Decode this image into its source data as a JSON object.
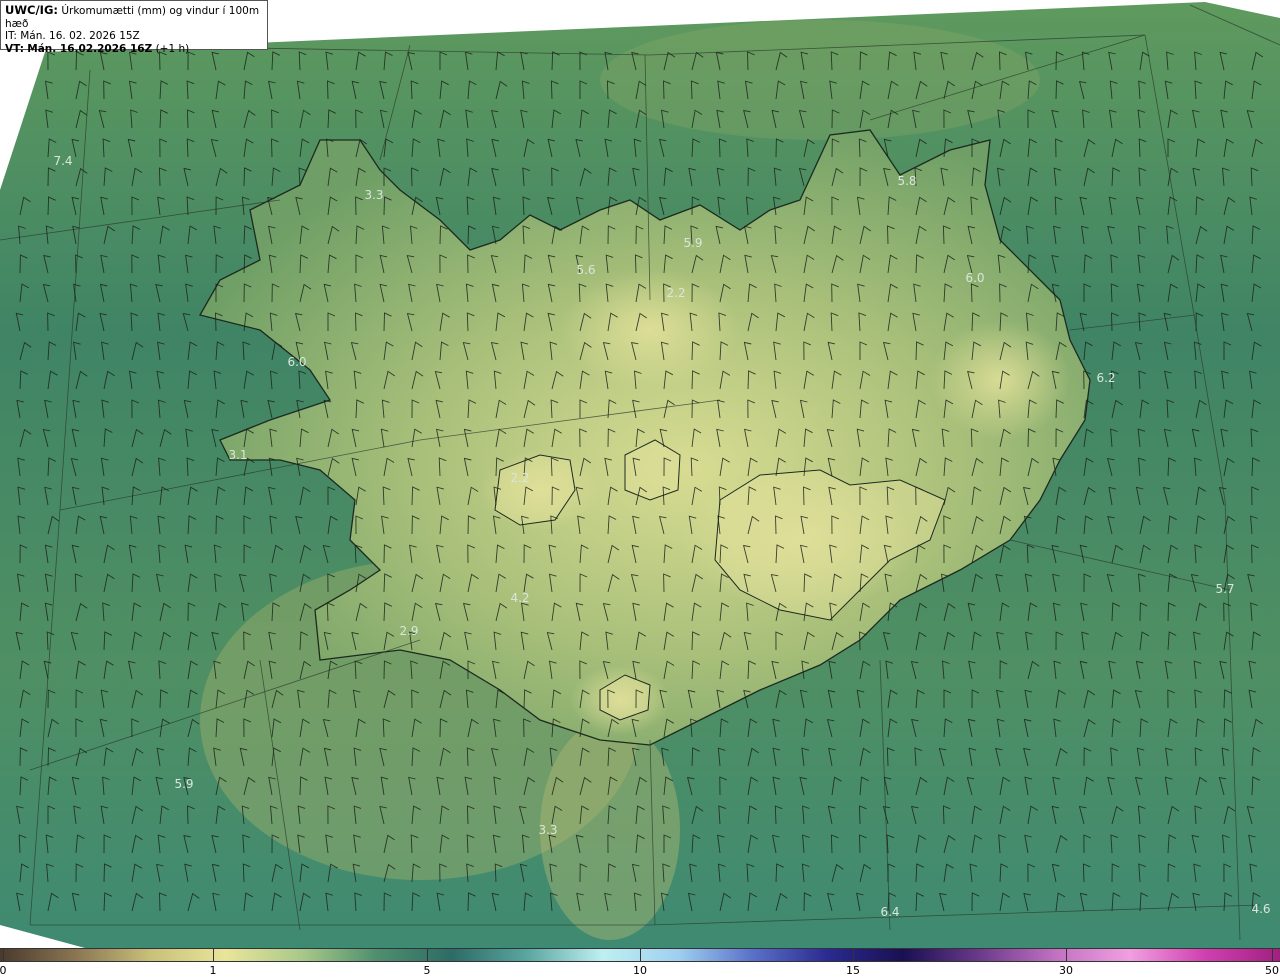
{
  "header": {
    "model": "UWC/IG:",
    "title": "Úrkomumætti (mm) og vindur í 100m hæð",
    "issue_time": "IT: Mán. 16. 02. 2026 15Z",
    "valid_label": "VT:",
    "valid_time": "Mán. 16.02.2026 16Z",
    "valid_offset": "(+1 h)"
  },
  "map_values": [
    "7.4",
    "3.3",
    "5.8",
    "5.9",
    "5.6",
    "2.2",
    "6.0",
    "6.2",
    "6.0",
    "3.1",
    "2.2",
    "4.2",
    "2.9",
    "5.7",
    "5.9",
    "3.3",
    "6.4",
    "4.6"
  ],
  "colorbar": {
    "ticks": [
      {
        "label": "0",
        "value": 0
      },
      {
        "label": "1",
        "value": 1
      },
      {
        "label": "5",
        "value": 5
      },
      {
        "label": "10",
        "value": 10
      },
      {
        "label": "15",
        "value": 15
      },
      {
        "label": "30",
        "value": 30
      },
      {
        "label": "50",
        "value": 50
      }
    ],
    "colors": [
      "#4a3a2e",
      "#8a7552",
      "#c9c07a",
      "#e9e59a",
      "#a9c98a",
      "#4f8f6e",
      "#2e6b66",
      "#5aa6a0",
      "#bfeff0",
      "#9fd0f0",
      "#5a70c8",
      "#2a2a90",
      "#1a1050",
      "#6a3a8a",
      "#c070c0",
      "#f0a0e0",
      "#d040b0",
      "#a02080"
    ]
  },
  "colors": {
    "ocean": "#3f8a6a",
    "land_low": "#5f9a62",
    "land_high": "#d6dc90"
  }
}
